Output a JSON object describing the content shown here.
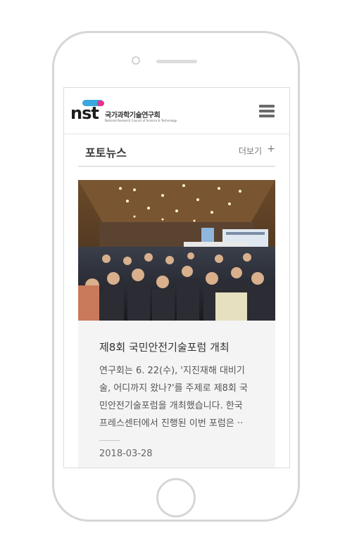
{
  "header": {
    "logo_text": "nst",
    "logo_korean": "국가과학기술연구회",
    "logo_english": "National Research Council of Science & Technology"
  },
  "section": {
    "title": "포토뉴스",
    "more_label": "더보기",
    "more_plus": "+"
  },
  "article": {
    "title": "제8회 국민안전기술포럼 개최",
    "summary_lines": [
      "연구회는 6. 22(수), '지진재해 대비기",
      "술, 어디까지 왔나?'를 주제로 제8회 국",
      "민안전기술포럼을 개최했습니다. 한국",
      "프레스센터에서 진행된 이번 포럼은 ··"
    ],
    "date": "2018-03-28"
  },
  "colors": {
    "logo_blue": "#3aa7df",
    "logo_pink": "#e6358a"
  }
}
